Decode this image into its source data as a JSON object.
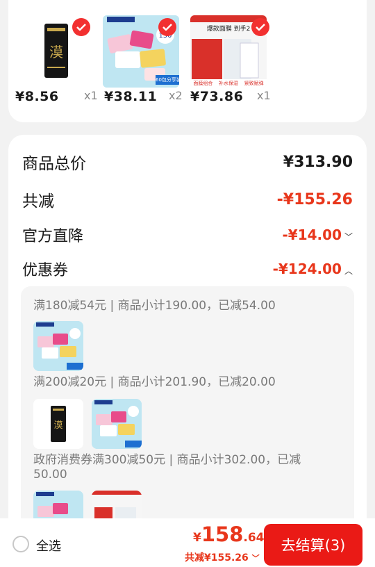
{
  "products": [
    {
      "price": "¥8.56",
      "qty": "x1"
    },
    {
      "price": "¥38.11",
      "qty": "x2"
    },
    {
      "price": "¥73.86",
      "qty": "x1"
    }
  ],
  "product_art": {
    "p2_badge": "60包分享装",
    "p3_banner": "爆款面膜 到手2",
    "p3_tags": [
      "面膜组合",
      "补水保湿",
      "紧致赋弹"
    ]
  },
  "summary": {
    "goods_total_label": "商品总价",
    "goods_total_value": "¥313.90",
    "reduced_label": "共减",
    "reduced_value": "-¥155.26",
    "official_label": "官方直降",
    "official_value": "-¥14.00",
    "coupon_label": "优惠券",
    "coupon_value": "-¥124.00"
  },
  "rules": [
    "满180减54元 | 商品小计190.00，已减54.00",
    "满200减20元 | 商品小计201.90，已减20.00",
    "政府消费券满300减50元 | 商品小计302.00，已减",
    "50.00"
  ],
  "bottom": {
    "select_all": "全选",
    "currency": "¥",
    "total_int": "158",
    "total_dec": ".64",
    "saved": "共减¥155.26",
    "checkout": "去结算(3)"
  },
  "colors": {
    "accent": "#e8361b",
    "checkout_bg": "#ea1a16"
  }
}
